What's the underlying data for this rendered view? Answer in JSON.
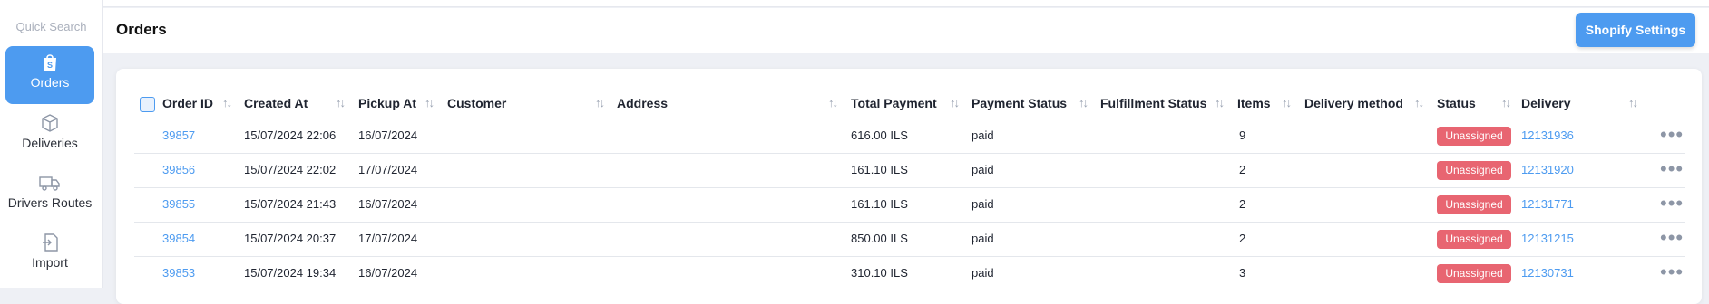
{
  "sidebar": {
    "quick_search": "Quick Search",
    "items": [
      {
        "label": "Orders",
        "icon": "shopify-bag-icon",
        "active": true
      },
      {
        "label": "Deliveries",
        "icon": "box-icon",
        "active": false
      },
      {
        "label": "Drivers Routes",
        "icon": "truck-icon",
        "active": false
      },
      {
        "label": "Import",
        "icon": "import-icon",
        "active": false
      }
    ]
  },
  "header": {
    "title": "Orders",
    "settings_button": "Shopify Settings"
  },
  "table": {
    "columns": [
      "Order ID",
      "Created At",
      "Pickup At",
      "Customer",
      "Address",
      "Total Payment",
      "Payment Status",
      "Fulfillment Status",
      "Items",
      "Delivery method",
      "Status",
      "Delivery"
    ],
    "rows": [
      {
        "order_id": "39857",
        "created_at": "15/07/2024 22:06",
        "pickup_at": "16/07/2024",
        "total": "616.00 ILS",
        "payment_status": "paid",
        "items": "9",
        "status": "Unassigned",
        "delivery": "12131936"
      },
      {
        "order_id": "39856",
        "created_at": "15/07/2024 22:02",
        "pickup_at": "17/07/2024",
        "total": "161.10 ILS",
        "payment_status": "paid",
        "items": "2",
        "status": "Unassigned",
        "delivery": "12131920"
      },
      {
        "order_id": "39855",
        "created_at": "15/07/2024 21:43",
        "pickup_at": "16/07/2024",
        "total": "161.10 ILS",
        "payment_status": "paid",
        "items": "2",
        "status": "Unassigned",
        "delivery": "12131771"
      },
      {
        "order_id": "39854",
        "created_at": "15/07/2024 20:37",
        "pickup_at": "17/07/2024",
        "total": "850.00 ILS",
        "payment_status": "paid",
        "items": "2",
        "status": "Unassigned",
        "delivery": "12131215"
      },
      {
        "order_id": "39853",
        "created_at": "15/07/2024 19:34",
        "pickup_at": "16/07/2024",
        "total": "310.10 ILS",
        "payment_status": "paid",
        "items": "3",
        "status": "Unassigned",
        "delivery": "12130731"
      }
    ]
  },
  "colors": {
    "accent": "#4d9bf0",
    "badge": "#e86571"
  }
}
